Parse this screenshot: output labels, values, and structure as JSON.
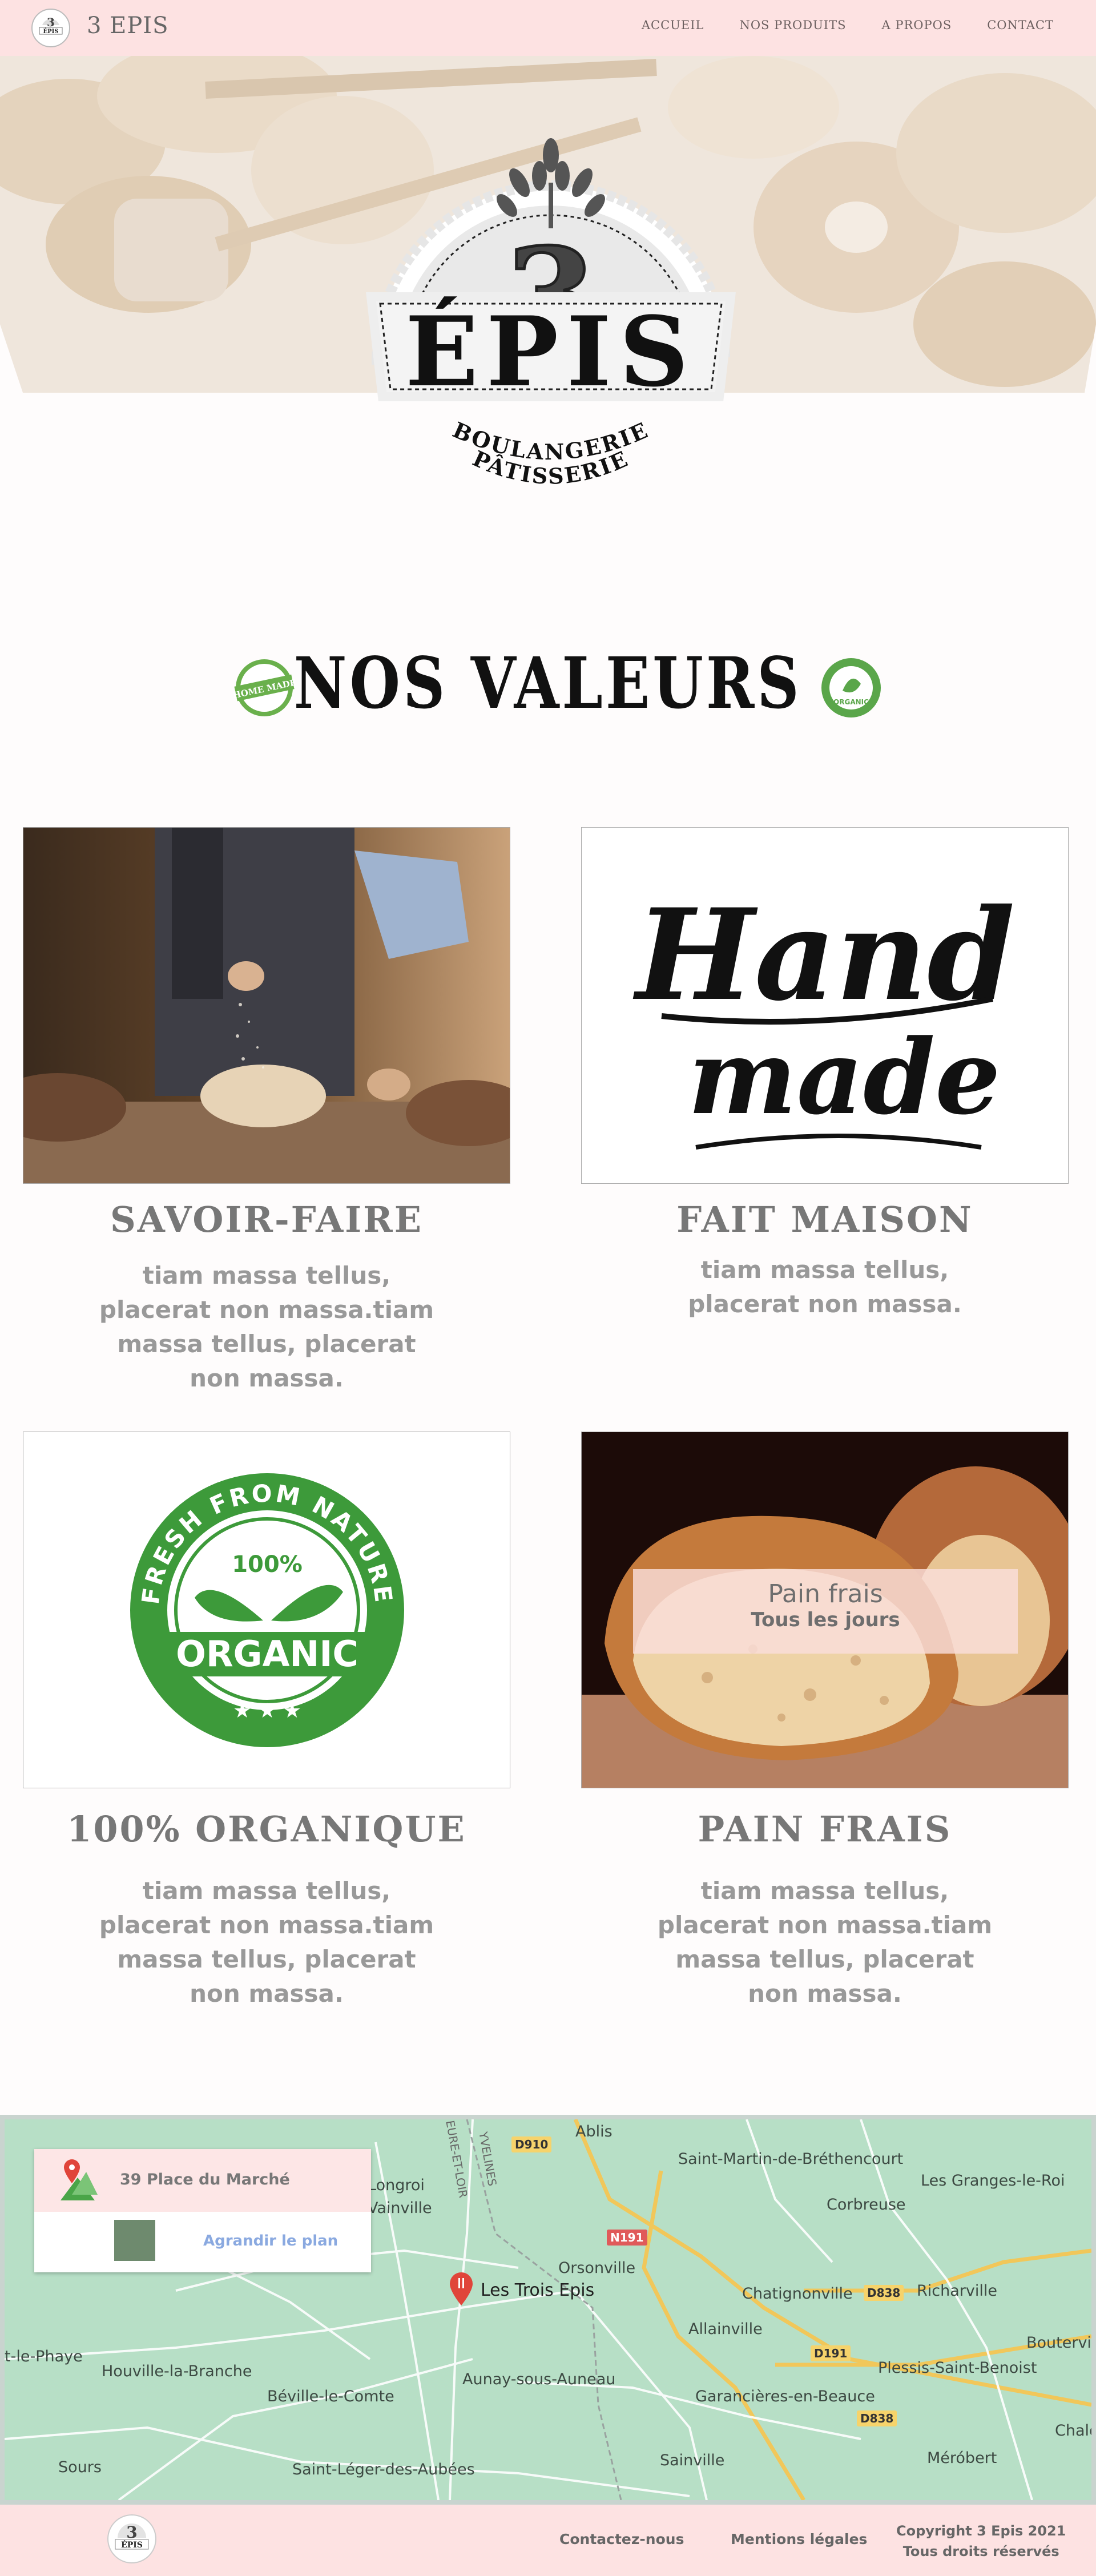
{
  "nav": {
    "brand": "3 EPIS",
    "items": [
      "ACCUEIL",
      "NOS PRODUITS",
      "A PROPOS",
      "CONTACT"
    ]
  },
  "hero": {
    "badge_number": "3",
    "badge_name": "ÉPIS",
    "badge_line1": "BOULANGERIE",
    "badge_line2": "PÂTISSERIE"
  },
  "valeurs": {
    "title": "NOS VALEURS",
    "stamp_left": "HOME MADE",
    "stamp_right": "ORGANIC"
  },
  "cards": [
    {
      "title": "SAVOIR-FAIRE",
      "text": "tiam massa tellus, placerat non massa.tiam massa tellus, placerat non massa."
    },
    {
      "title": "FAIT MAISON",
      "text": "tiam massa tellus, placerat non massa.",
      "image_text": [
        "Hand",
        "made"
      ]
    },
    {
      "title": "100% ORGANIQUE",
      "text": "tiam massa tellus, placerat non massa.tiam massa tellus, placerat non massa.",
      "image_text": [
        "FRESH FROM NATURE",
        "100%",
        "ORGANIC"
      ]
    },
    {
      "title": "PAIN FRAIS",
      "text": "tiam massa tellus, placerat non massa.tiam massa tellus, placerat non massa.",
      "overlay_title": "Pain frais",
      "overlay_sub": "Tous les jours"
    }
  ],
  "map": {
    "address": "39 Place du Marché",
    "enlarge": "Agrandir le plan",
    "pin_label": "Les Trois Epis",
    "places": [
      "Ablis",
      "Saint-Martin-de-Bréthencourt",
      "Les Granges-le-Roi",
      "Corbreuse",
      "Orsonville",
      "Longroi",
      "Vainville",
      "Richarville",
      "Chatignonville",
      "Allainville",
      "Bouterville",
      "Plessis-Saint-Benoist",
      "Houville-la-Branche",
      "Aunay-sous-Auneau",
      "Béville-le-Comte",
      "Garancières-en-Beauce",
      "Chalo-S",
      "Méróbert",
      "Sainville",
      "Saint-Léger-des-Aubées",
      "Sours",
      "t-le-Phaye",
      "YVELINES",
      "EURE-ET-LOIR"
    ],
    "roads": [
      "D910",
      "N191",
      "D838",
      "D191",
      "D838"
    ]
  },
  "footer": {
    "contact": "Contactez-nous",
    "legal": "Mentions légales",
    "copyright": "Copyright 3 Epis 2021",
    "rights": "Tous droits réservés"
  }
}
